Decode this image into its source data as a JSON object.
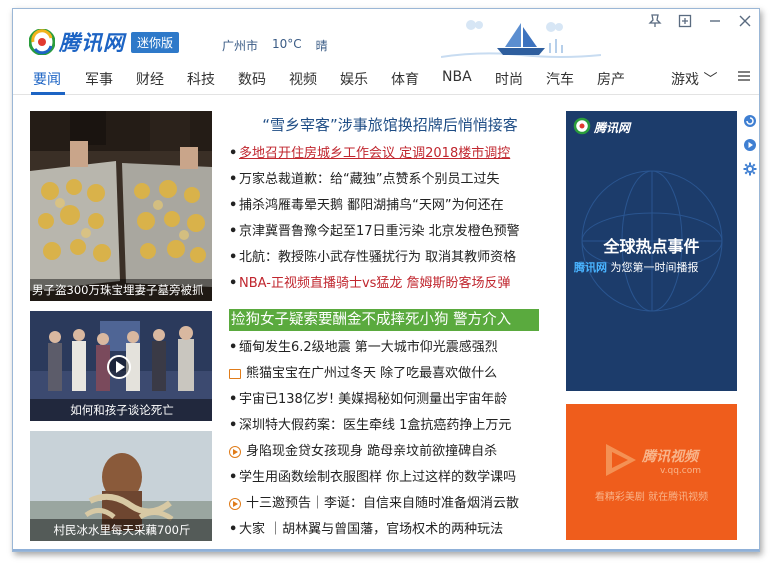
{
  "header": {
    "logo_text": "腾讯网",
    "badge": "迷你版",
    "weather": {
      "city": "广州市",
      "temp": "10°C",
      "condition": "晴"
    }
  },
  "nav": {
    "items": [
      "要闻",
      "军事",
      "财经",
      "科技",
      "数码",
      "视频",
      "娱乐",
      "体育",
      "NBA",
      "时尚",
      "汽车",
      "房产"
    ],
    "active": "要闻",
    "more": "游戏 ﹀"
  },
  "photos": [
    {
      "caption": "男子盗300万珠宝埋妻子墓旁被抓"
    },
    {
      "caption": "如何和孩子谈论死亡"
    },
    {
      "caption": "村民冰水里每天采藕700斤"
    }
  ],
  "headline": "“雪乡宰客”涉事旅馆换招牌后悄悄接客",
  "news_top": [
    {
      "text": "多地召开住房城乡工作会议 定调2018楼市调控",
      "style": "red-underline"
    },
    {
      "text": "万家总裁道歉：给“藏独”点赞系个别员工过失",
      "style": ""
    },
    {
      "text": "捕杀鸿雁毒晕天鹅 鄱阳湖捕鸟“天网”为何还在",
      "style": ""
    },
    {
      "text": "京津冀晋鲁豫今起至17日重污染 北京发橙色预警",
      "style": ""
    },
    {
      "text": "北航：教授陈小武存性骚扰行为 取消其教师资格",
      "style": ""
    },
    {
      "text": "NBA-正视频直播骑士vs猛龙 詹姆斯盼客场反弹",
      "style": "red"
    }
  ],
  "highlight": "捡狗女子疑索要酬金不成摔死小狗 警方介入",
  "news_bottom": [
    {
      "text": "缅甸发生6.2级地震 第一大城市仰光震感强烈",
      "icon": "bullet"
    },
    {
      "text": "熊猫宝宝在广州过冬天 除了吃最喜欢做什么",
      "icon": "picture"
    },
    {
      "text": "宇宙已138亿岁! 美媒揭秘如何测量出宇宙年龄",
      "icon": "bullet"
    },
    {
      "text": "深圳特大假药案：医生牵线 1盒抗癌药挣上万元",
      "icon": "bullet"
    },
    {
      "text": "身陷现金贷女孩现身 跪母亲坟前欲撞碑自杀",
      "icon": "play"
    },
    {
      "text": "学生用函数绘制衣服图样 你上过这样的数学课吗",
      "icon": "bullet"
    },
    {
      "text": "十三邀预告｜李诞：自信来自随时准备烟消云散",
      "icon": "play"
    },
    {
      "text": "大家 ｜胡林翼与曾国藩，官场权术的两种玩法",
      "icon": "bullet"
    }
  ],
  "ads": {
    "blue": {
      "brand": "腾讯网",
      "title": "全球热点事件",
      "sub_brand": "腾讯网",
      "sub_text": "为您第一时间播报"
    },
    "orange": {
      "brand": "腾讯视频",
      "url": "v.qq.com",
      "text": "看精彩美剧 就在腾讯视频"
    }
  },
  "colors": {
    "brand_blue": "#1d64c4",
    "highlight_green": "#5aaa3e",
    "ad_blue": "#1c3c6b",
    "ad_orange": "#ef5d1c",
    "news_red": "#c0262e"
  }
}
